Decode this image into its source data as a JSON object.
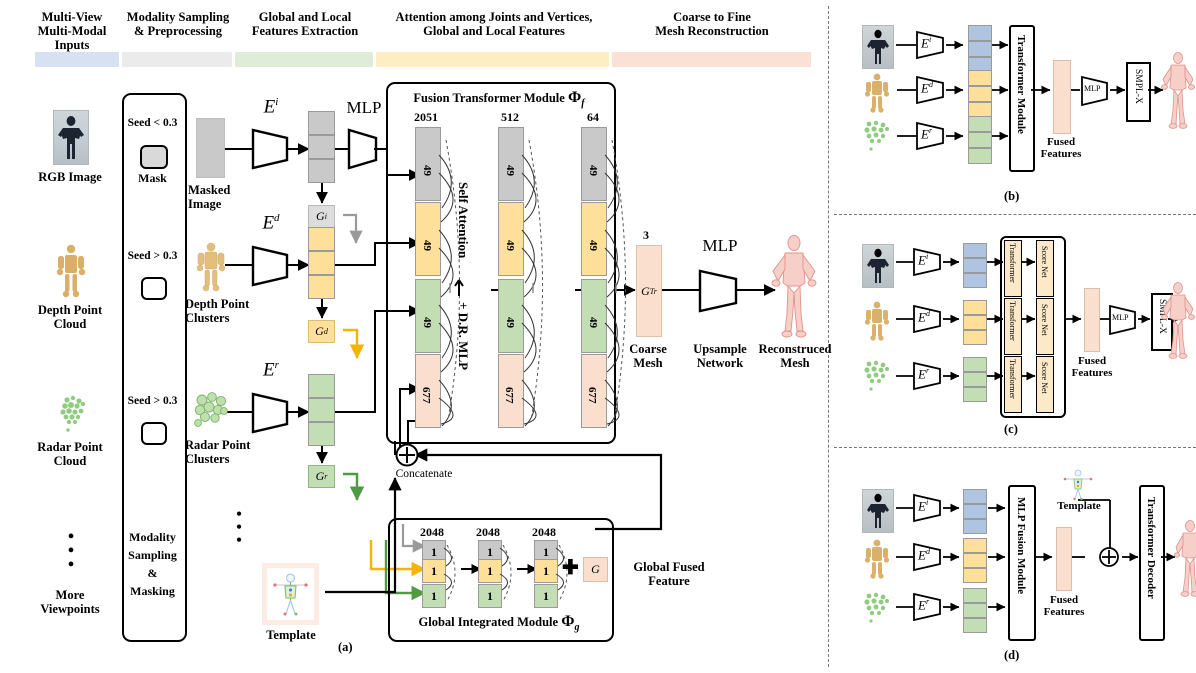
{
  "figure": {
    "caption_a": "(a)",
    "caption_b": "(b)",
    "caption_c": "(c)",
    "caption_d": "(d)"
  },
  "stage_headers": [
    {
      "line1": "Multi-View",
      "line2": "Multi-Modal Inputs",
      "color": "#d7e1f2"
    },
    {
      "line1": "Modality Sampling",
      "line2": "& Preprocessing",
      "color": "#ebebeb"
    },
    {
      "line1": "Global and Local",
      "line2": "Features Extraction",
      "color": "#dfecd7"
    },
    {
      "line1": "Attention among Joints and Vertices,",
      "line2": "Global and Local Features",
      "color": "#ffeec4"
    },
    {
      "line1": "Coarse to Fine",
      "line2": "Mesh Reconstruction",
      "color": "#f9e2d5"
    }
  ],
  "inputs": {
    "rgb_label_l1": "RGB Image",
    "depth_label_l1": "Depth Point",
    "depth_label_l2": "Cloud",
    "radar_label_l1": "Radar Point",
    "radar_label_l2": "Cloud",
    "more_label_l1": "More",
    "more_label_l2": "Viewpoints",
    "vdots": "•"
  },
  "sampling": {
    "seed_rgb": "Seed < 0.3",
    "mask_label": "Mask",
    "seed_depth": "Seed > 0.3",
    "seed_radar": "Seed > 0.3",
    "module_l1": "Modality",
    "module_l2": "Sampling",
    "module_l3": "&",
    "module_l4": "Masking"
  },
  "extraction": {
    "encoder_image": "E",
    "encoder_image_sup": "i",
    "encoder_depth": "E",
    "encoder_depth_sup": "d",
    "encoder_radar": "E",
    "encoder_radar_sup": "r",
    "mlp_label": "MLP",
    "masked_image_l1": "Masked",
    "masked_image_l2": "Image",
    "depth_clusters_l1": "Depth Point",
    "depth_clusters_l2": "Clusters",
    "radar_clusters_l1": "Radar Point",
    "radar_clusters_l2": "Clusters",
    "gi": "G",
    "gi_sup": "i",
    "gd": "G",
    "gd_sup": "d",
    "gr": "G",
    "gr_sup": "r",
    "template_label": "Template"
  },
  "fusion_module": {
    "title": "Fusion Transformer Module",
    "symbol": "Φ",
    "symbol_sub": "f",
    "col_dims": [
      "2051",
      "512",
      "64"
    ],
    "token_rows": [
      "49",
      "49",
      "49",
      "677"
    ],
    "row_colors": [
      "#c9c9c9",
      "#ffe09a",
      "#c3ddb5",
      "#fadfce"
    ],
    "side_label_l1": "Self Attention",
    "side_label_l2": "+ D.R. MLP"
  },
  "coarse": {
    "dim": "3",
    "symbol": "G",
    "symbol_sup": "Tr",
    "mlp_label": "MLP",
    "coarse_l1": "Coarse",
    "coarse_l2": "Mesh",
    "upsample_l1": "Upsample",
    "upsample_l2": "Network",
    "recon_l1": "Reconstruced",
    "recon_l2": "Mesh"
  },
  "global_module": {
    "concat_label": "Concatenate",
    "title": "Global Integrated Module",
    "symbol": "Φ",
    "symbol_sub": "g",
    "col_dims": [
      "2048",
      "2048",
      "2048"
    ],
    "cell_value": "1",
    "row_colors": [
      "#c9c9c9",
      "#ffe09a",
      "#c3ddb5"
    ],
    "plus": "✚",
    "g_label": "G",
    "gff_l1": "Global Fused",
    "gff_l2": "Feature"
  },
  "panel_b": {
    "encoders": [
      "E",
      "E",
      "E"
    ],
    "encoder_sups": [
      "i",
      "d",
      "r"
    ],
    "module_label": "Transformer Module",
    "fused_l1": "Fused",
    "fused_l2": "Features",
    "mlp_label": "MLP",
    "smplx_label": "SMPL-X",
    "feature_colors": [
      "#aec4e0",
      "#ffe09a",
      "#c3ddb5"
    ],
    "fused_color": "#fadfce"
  },
  "panel_c": {
    "encoders": [
      "E",
      "E",
      "E"
    ],
    "encoder_sups": [
      "i",
      "d",
      "r"
    ],
    "transformer_label": "Transformer",
    "scorenet_label": "Score Net",
    "fused_l1": "Fused",
    "fused_l2": "Features",
    "mlp_label": "MLP",
    "smplx_label": "SMPL-X",
    "feature_colors": [
      "#aec4e0",
      "#ffe09a",
      "#c3ddb5"
    ],
    "inner_color": "#fbe9c8",
    "fused_color": "#fadfce"
  },
  "panel_d": {
    "encoders": [
      "E",
      "E",
      "E"
    ],
    "encoder_sups": [
      "i",
      "d",
      "r"
    ],
    "fusion_label": "MLP Fusion Module",
    "fused_l1": "Fused",
    "fused_l2": "Features",
    "template_label": "Template",
    "decoder_label": "Transformer Decoder",
    "feature_colors": [
      "#aec4e0",
      "#ffe09a",
      "#c3ddb5"
    ],
    "fused_color": "#fadfce"
  },
  "colors": {
    "gray": "#c9c9c9",
    "yellow": "#ffe09a",
    "green": "#c3ddb5",
    "peach": "#fadfce",
    "blue": "#aec4e0",
    "arrow_yellow": "#f5b400",
    "arrow_green": "#4f9a42",
    "arrow_gray": "#9a9a9a"
  }
}
